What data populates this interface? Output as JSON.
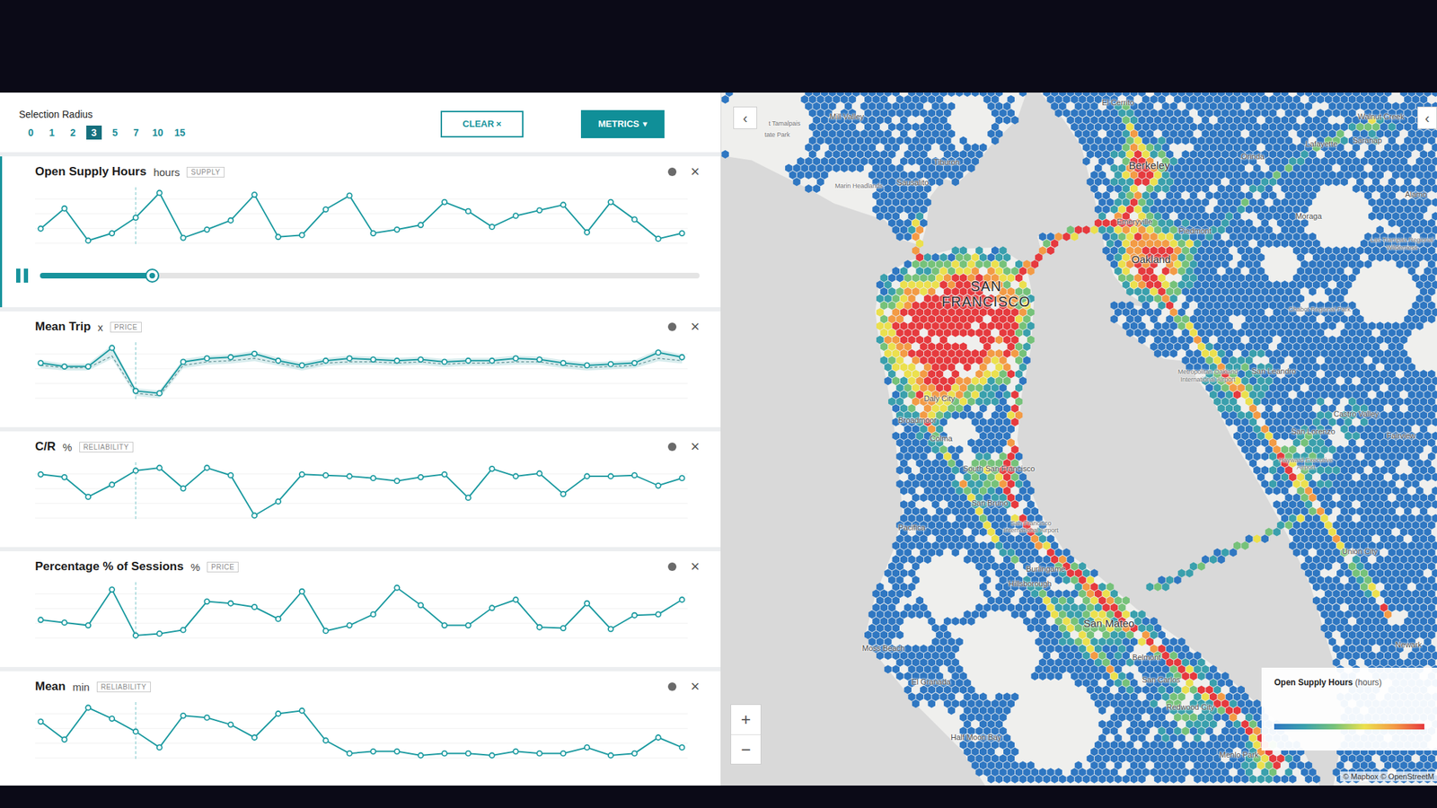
{
  "toolbar": {
    "radius_label": "Selection Radius",
    "radius_options": [
      {
        "label": "0",
        "selected": false
      },
      {
        "label": "1",
        "selected": false
      },
      {
        "label": "2",
        "selected": false
      },
      {
        "label": "3",
        "selected": true
      },
      {
        "label": "5",
        "selected": false
      },
      {
        "label": "7",
        "selected": false
      },
      {
        "label": "10",
        "selected": false
      },
      {
        "label": "15",
        "selected": false
      }
    ],
    "clear_button": {
      "label": "CLEAR",
      "icon": "×"
    },
    "metrics_button": {
      "label": "METRICS",
      "icon": "▾"
    }
  },
  "playback": {
    "playing": true,
    "level": 0.17,
    "cursor_index": 4
  },
  "card_close_icon": "×",
  "metrics": [
    {
      "title": "Open Supply Hours",
      "unit": "hours",
      "tag": "SUPPLY",
      "selected": true,
      "kind": "line",
      "values": [
        15,
        37,
        2,
        10,
        27,
        54,
        5,
        14,
        24,
        52,
        6,
        8,
        36,
        51,
        10,
        14,
        19,
        44,
        34,
        17,
        29,
        35,
        41,
        11,
        44,
        25,
        4,
        10
      ]
    },
    {
      "title": "Mean Trip",
      "unit": "x",
      "tag": "PRICE",
      "selected": false,
      "kind": "band",
      "values": [
        34,
        31,
        31,
        47,
        10,
        8,
        35,
        38,
        39,
        42,
        36,
        32,
        36,
        38,
        37,
        36,
        37,
        35,
        36,
        36,
        38,
        37,
        34,
        32,
        33,
        34,
        43,
        39
      ],
      "baseline": [
        32,
        30,
        30,
        40,
        8,
        6,
        32,
        35,
        36,
        38,
        34,
        30,
        34,
        35,
        35,
        34,
        35,
        33,
        34,
        34,
        35,
        35,
        32,
        30,
        31,
        32,
        38,
        36
      ]
    },
    {
      "title": "C/R",
      "unit": "%",
      "tag": "RELIABILITY",
      "selected": false,
      "kind": "line",
      "values": [
        51,
        48,
        27,
        40,
        55,
        58,
        36,
        58,
        50,
        7,
        22,
        51,
        50,
        49,
        47,
        44,
        48,
        51,
        26,
        57,
        49,
        52,
        30,
        49,
        49,
        50,
        39,
        47
      ]
    },
    {
      "title": "Percentage % of Sessions",
      "unit": "%",
      "tag": "PRICE",
      "selected": false,
      "kind": "line",
      "values": [
        24,
        21,
        18,
        57,
        7,
        9,
        13,
        44,
        42,
        38,
        25,
        55,
        12,
        18,
        30,
        59,
        40,
        18,
        18,
        37,
        46,
        16,
        15,
        42,
        14,
        29,
        30,
        46
      ]
    },
    {
      "title": "Mean",
      "unit": "min",
      "tag": "RELIABILITY",
      "selected": false,
      "kind": "line",
      "values": [
        39,
        21,
        53,
        42,
        29,
        13,
        45,
        43,
        36,
        23,
        47,
        50,
        20,
        7,
        9,
        9,
        5,
        7,
        7,
        5,
        9,
        7,
        7,
        13,
        5,
        7,
        23,
        13
      ]
    }
  ],
  "map": {
    "collapse_left": "‹",
    "collapse_right": "‹",
    "zoom_in": "+",
    "zoom_out": "−",
    "labels": [
      {
        "text": "t Tamalpais",
        "kind": "area"
      },
      {
        "text": "tate Park",
        "kind": "area"
      },
      {
        "text": "Mill Valley",
        "kind": "city"
      },
      {
        "text": "Tiburon",
        "kind": "city"
      },
      {
        "text": "Marin Headlands",
        "kind": "area"
      },
      {
        "text": "Sausalito",
        "kind": "city"
      },
      {
        "text": "El Cerrito",
        "kind": "city"
      },
      {
        "text": "Berkeley",
        "kind": "town"
      },
      {
        "text": "Emeryville",
        "kind": "city"
      },
      {
        "text": "Piedmont",
        "kind": "city"
      },
      {
        "text": "Oakland",
        "kind": "town"
      },
      {
        "text": "Orinda",
        "kind": "city"
      },
      {
        "text": "Walnut Creek",
        "kind": "city"
      },
      {
        "text": "Lafayette",
        "kind": "city"
      },
      {
        "text": "Saranap",
        "kind": "city"
      },
      {
        "text": "Alamo",
        "kind": "city"
      },
      {
        "text": "Moraga",
        "kind": "city"
      },
      {
        "text": "Las Trampas Regional Wilderness",
        "kind": "area"
      },
      {
        "text": "Chabot Regional Park",
        "kind": "area"
      },
      {
        "text": "SAN FRANCISCO",
        "kind": "major"
      },
      {
        "text": "Metropolitan Oakland International Airport",
        "kind": "area"
      },
      {
        "text": "San Leandro",
        "kind": "city"
      },
      {
        "text": "Castro Valley",
        "kind": "city"
      },
      {
        "text": "San Lorenzo",
        "kind": "city"
      },
      {
        "text": "Fairview",
        "kind": "city"
      },
      {
        "text": "Hayward Executive Airport",
        "kind": "area"
      },
      {
        "text": "Union City",
        "kind": "city"
      },
      {
        "text": "Newark",
        "kind": "city"
      },
      {
        "text": "Daly City",
        "kind": "city"
      },
      {
        "text": "Broadmoor",
        "kind": "city"
      },
      {
        "text": "Colma",
        "kind": "city"
      },
      {
        "text": "South San Francisco",
        "kind": "city"
      },
      {
        "text": "San Bruno",
        "kind": "city"
      },
      {
        "text": "San Francisco International Airport",
        "kind": "area"
      },
      {
        "text": "Pacifica",
        "kind": "city"
      },
      {
        "text": "Burlingame",
        "kind": "city"
      },
      {
        "text": "Hillsborough",
        "kind": "city"
      },
      {
        "text": "San Mateo",
        "kind": "town"
      },
      {
        "text": "Belmont",
        "kind": "city"
      },
      {
        "text": "San Carlos",
        "kind": "city"
      },
      {
        "text": "Redwood City",
        "kind": "city"
      },
      {
        "text": "Moss Beach",
        "kind": "city"
      },
      {
        "text": "El Granada",
        "kind": "city"
      },
      {
        "text": "Half Moon Bay",
        "kind": "city"
      },
      {
        "text": "Menlo Park",
        "kind": "city"
      }
    ],
    "legend": {
      "title": "Open Supply Hours",
      "unit": "(hours)"
    },
    "attribution": "© Mapbox © OpenStreetM"
  }
}
